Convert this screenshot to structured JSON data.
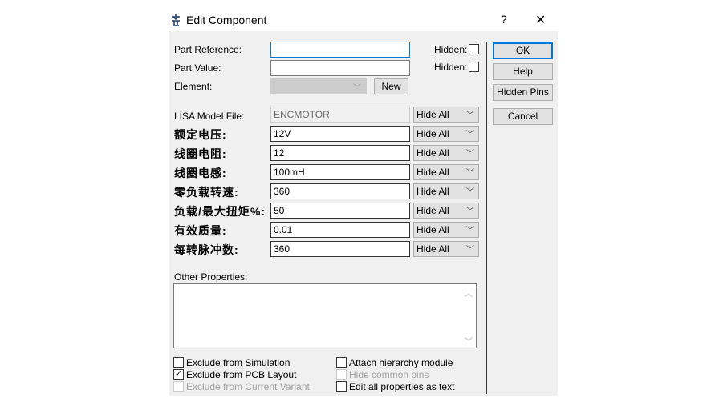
{
  "window": {
    "title": "Edit Component",
    "help": "?",
    "close": "✕"
  },
  "part_reference": {
    "label": "Part Reference:",
    "value": "",
    "hidden_label": "Hidden:",
    "hidden": false
  },
  "part_value": {
    "label": "Part Value:",
    "value": "",
    "hidden_label": "Hidden:",
    "hidden": false
  },
  "element": {
    "label": "Element:",
    "value": "",
    "new_label": "New"
  },
  "lisa": {
    "label": "LISA Model File:",
    "value": "ENCMOTOR",
    "visibility": "Hide All"
  },
  "properties": [
    {
      "label": "额定电压:",
      "value": "12V",
      "visibility": "Hide All"
    },
    {
      "label": "线圈电阻:",
      "value": "12",
      "visibility": "Hide All"
    },
    {
      "label": "线圈电感:",
      "value": "100mH",
      "visibility": "Hide All"
    },
    {
      "label": "零负载转速:",
      "value": "360",
      "visibility": "Hide All"
    },
    {
      "label": "负载/最大扭矩%:",
      "value": "50",
      "visibility": "Hide All"
    },
    {
      "label": "有效质量:",
      "value": "0.01",
      "visibility": "Hide All"
    },
    {
      "label": "每转脉冲数:",
      "value": "360",
      "visibility": "Hide All"
    }
  ],
  "other_properties": {
    "label": "Other Properties:",
    "value": ""
  },
  "checkboxes": [
    {
      "label": "Exclude from Simulation",
      "checked": false,
      "enabled": true
    },
    {
      "label": "Exclude from PCB Layout",
      "checked": true,
      "enabled": true
    },
    {
      "label": "Exclude from Current Variant",
      "checked": false,
      "enabled": false
    },
    {
      "label": "Attach hierarchy module",
      "checked": false,
      "enabled": true
    },
    {
      "label": "Hide common pins",
      "checked": false,
      "enabled": false
    },
    {
      "label": "Edit all properties as text",
      "checked": false,
      "enabled": true
    }
  ],
  "buttons": {
    "ok": "OK",
    "help": "Help",
    "hidden_pins": "Hidden Pins",
    "cancel": "Cancel"
  }
}
